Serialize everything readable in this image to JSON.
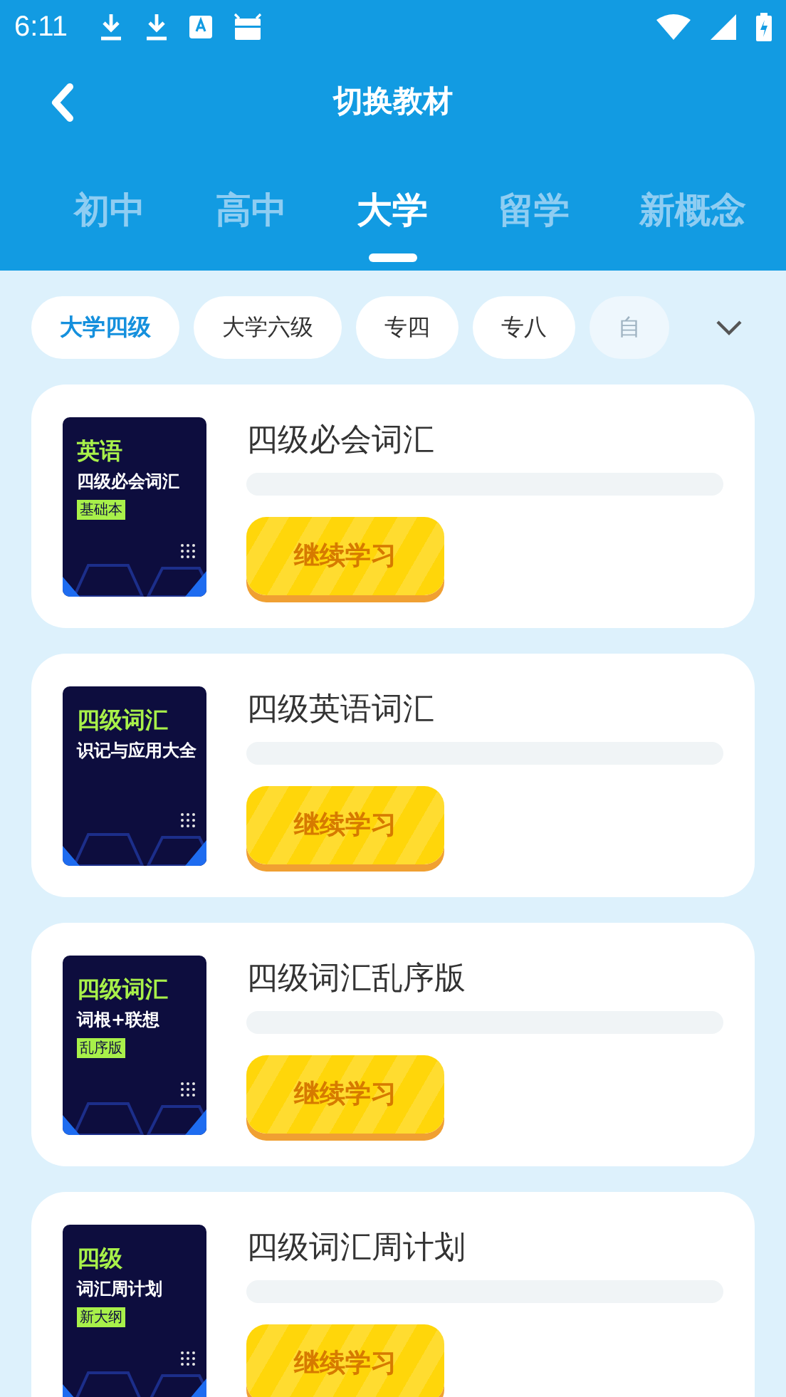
{
  "status_bar": {
    "time": "6:11"
  },
  "header": {
    "title": "切换教材"
  },
  "tabs": [
    {
      "label": "初中",
      "selected": false
    },
    {
      "label": "高中",
      "selected": false
    },
    {
      "label": "大学",
      "selected": true
    },
    {
      "label": "留学",
      "selected": false
    },
    {
      "label": "新概念",
      "selected": false
    }
  ],
  "chips": [
    {
      "label": "大学四级",
      "selected": true,
      "faded": false
    },
    {
      "label": "大学六级",
      "selected": false,
      "faded": false
    },
    {
      "label": "专四",
      "selected": false,
      "faded": false
    },
    {
      "label": "专八",
      "selected": false,
      "faded": false
    },
    {
      "label": "自",
      "selected": false,
      "faded": true
    }
  ],
  "books": [
    {
      "cover_lines": [
        "英语",
        "四级必会词汇"
      ],
      "cover_tag": "基础本",
      "title": "四级必会词汇",
      "level": 0,
      "button": "继续学习"
    },
    {
      "cover_lines": [
        "四级词汇",
        "识记与应用大全"
      ],
      "title": "四级英语词汇",
      "level": 0,
      "button": "继续学习"
    },
    {
      "cover_lines": [
        "四级词汇",
        "词根+联想"
      ],
      "cover_tag": "乱序版",
      "title": "四级词汇乱序版",
      "level": 0,
      "button": "继续学习"
    },
    {
      "cover_lines": [
        "四级",
        "词汇周计划"
      ],
      "cover_tag": "新大纲",
      "title": "四级词汇周计划",
      "level": 0,
      "button": "继续学习"
    }
  ]
}
